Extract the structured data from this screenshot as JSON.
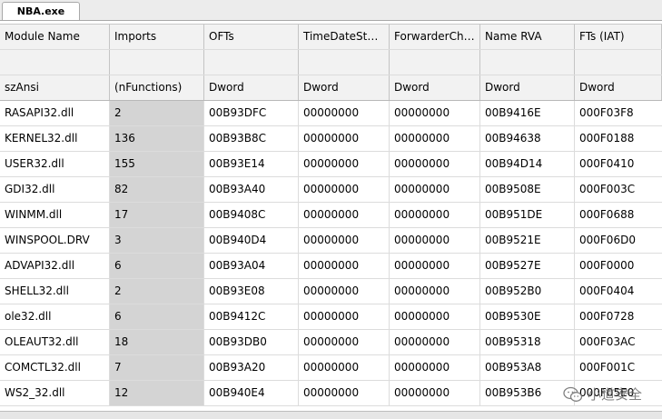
{
  "tab": {
    "label": "NBA.exe"
  },
  "columns": [
    {
      "name": "Module Name",
      "type": "szAnsi"
    },
    {
      "name": "Imports",
      "type": "(nFunctions)"
    },
    {
      "name": "OFTs",
      "type": "Dword"
    },
    {
      "name": "TimeDateSta...",
      "type": "Dword"
    },
    {
      "name": "ForwarderCha...",
      "type": "Dword"
    },
    {
      "name": "Name RVA",
      "type": "Dword"
    },
    {
      "name": "FTs (IAT)",
      "type": "Dword"
    }
  ],
  "rows": [
    [
      "RASAPI32.dll",
      "2",
      "00B93DFC",
      "00000000",
      "00000000",
      "00B9416E",
      "000F03F8"
    ],
    [
      "KERNEL32.dll",
      "136",
      "00B93B8C",
      "00000000",
      "00000000",
      "00B94638",
      "000F0188"
    ],
    [
      "USER32.dll",
      "155",
      "00B93E14",
      "00000000",
      "00000000",
      "00B94D14",
      "000F0410"
    ],
    [
      "GDI32.dll",
      "82",
      "00B93A40",
      "00000000",
      "00000000",
      "00B9508E",
      "000F003C"
    ],
    [
      "WINMM.dll",
      "17",
      "00B9408C",
      "00000000",
      "00000000",
      "00B951DE",
      "000F0688"
    ],
    [
      "WINSPOOL.DRV",
      "3",
      "00B940D4",
      "00000000",
      "00000000",
      "00B9521E",
      "000F06D0"
    ],
    [
      "ADVAPI32.dll",
      "6",
      "00B93A04",
      "00000000",
      "00000000",
      "00B9527E",
      "000F0000"
    ],
    [
      "SHELL32.dll",
      "2",
      "00B93E08",
      "00000000",
      "00000000",
      "00B952B0",
      "000F0404"
    ],
    [
      "ole32.dll",
      "6",
      "00B9412C",
      "00000000",
      "00000000",
      "00B9530E",
      "000F0728"
    ],
    [
      "OLEAUT32.dll",
      "18",
      "00B93DB0",
      "00000000",
      "00000000",
      "00B95318",
      "000F03AC"
    ],
    [
      "COMCTL32.dll",
      "7",
      "00B93A20",
      "00000000",
      "00000000",
      "00B953A8",
      "000F001C"
    ],
    [
      "WS2_32.dll",
      "12",
      "00B940E4",
      "00000000",
      "00000000",
      "00B953B6",
      "000F05E0"
    ]
  ],
  "watermark": {
    "text": "小道安全",
    "icon": "wechat-icon"
  }
}
